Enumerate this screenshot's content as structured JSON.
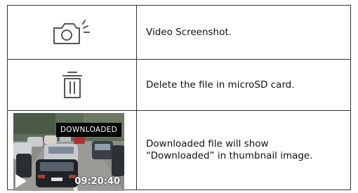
{
  "rows": [
    {
      "icon": "camera-flash-icon",
      "description": "Video Screenshot."
    },
    {
      "icon": "trash-icon",
      "description": "Delete the file in microSD card."
    },
    {
      "icon": "thumbnail-image",
      "description": "Downloaded file will show\n“Downloaded” in thumbnail image."
    }
  ],
  "thumbnail": {
    "badge": "DOWNLOADED",
    "timestamp": "09:20:40"
  },
  "colors": {
    "border": "#333333",
    "text": "#111111",
    "icon": "#555555",
    "badge_bg": "#000000"
  }
}
